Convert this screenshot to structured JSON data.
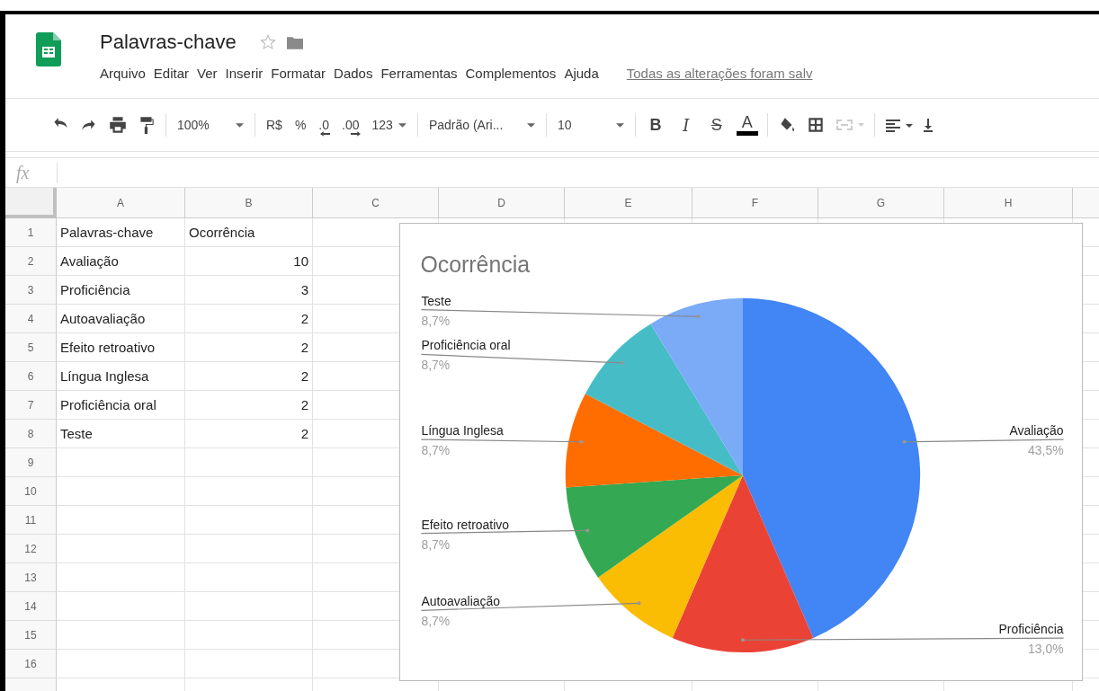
{
  "document": {
    "title": "Palavras-chave",
    "starred": false
  },
  "menu": [
    "Arquivo",
    "Editar",
    "Ver",
    "Inserir",
    "Formatar",
    "Dados",
    "Ferramentas",
    "Complementos",
    "Ajuda"
  ],
  "save_status": "Todas as alterações foram salv",
  "toolbar": {
    "zoom": "100%",
    "currency": "R$",
    "percent": "%",
    "decrease_decimals": ".0",
    "increase_decimals": ".00",
    "number_format": "123",
    "font": "Padrão (Ari...",
    "font_size": "10",
    "format_buttons": [
      {
        "label": "B",
        "kind": "bold"
      },
      {
        "label": "I",
        "kind": "italic"
      },
      {
        "label": "S",
        "kind": "strike"
      },
      {
        "label": "A",
        "kind": "color"
      }
    ],
    "merge_disabled": true
  },
  "formula_bar": {
    "label": "fx"
  },
  "columns": [
    "A",
    "B",
    "C",
    "D",
    "E",
    "F",
    "G",
    "H"
  ],
  "rows": [
    {
      "number": "1",
      "cells": [
        {
          "text": "Palavras-chave",
          "numeric": false
        },
        {
          "text": "Ocorrência",
          "numeric": false
        }
      ]
    },
    {
      "number": "2",
      "cells": [
        {
          "text": "Avaliação",
          "numeric": false
        },
        {
          "text": "10",
          "numeric": true
        }
      ]
    },
    {
      "number": "3",
      "cells": [
        {
          "text": "Proficiência",
          "numeric": false
        },
        {
          "text": "3",
          "numeric": true
        }
      ]
    },
    {
      "number": "4",
      "cells": [
        {
          "text": "Autoavaliação",
          "numeric": false
        },
        {
          "text": "2",
          "numeric": true
        }
      ]
    },
    {
      "number": "5",
      "cells": [
        {
          "text": "Efeito retroativo",
          "numeric": false
        },
        {
          "text": "2",
          "numeric": true
        }
      ]
    },
    {
      "number": "6",
      "cells": [
        {
          "text": "Língua Inglesa",
          "numeric": false
        },
        {
          "text": "2",
          "numeric": true
        }
      ]
    },
    {
      "number": "7",
      "cells": [
        {
          "text": "Proficiência oral",
          "numeric": false
        },
        {
          "text": "2",
          "numeric": true
        }
      ]
    },
    {
      "number": "8",
      "cells": [
        {
          "text": "Teste",
          "numeric": false
        },
        {
          "text": "2",
          "numeric": true
        }
      ]
    },
    {
      "number": "9",
      "cells": []
    },
    {
      "number": "10",
      "cells": []
    },
    {
      "number": "11",
      "cells": []
    },
    {
      "number": "12",
      "cells": []
    },
    {
      "number": "13",
      "cells": []
    },
    {
      "number": "14",
      "cells": []
    },
    {
      "number": "15",
      "cells": []
    },
    {
      "number": "16",
      "cells": []
    }
  ],
  "chart": {
    "chart_data": {
      "type": "pie",
      "title": "Ocorrência",
      "categories": [
        "Avaliação",
        "Proficiência",
        "Autoavaliação",
        "Efeito retroativo",
        "Língua Inglesa",
        "Proficiência oral",
        "Teste"
      ],
      "values": [
        43.5,
        13.0,
        8.7,
        8.7,
        8.7,
        8.7,
        8.7
      ],
      "colors": [
        "#4285f4",
        "#ea4335",
        "#fbbc04",
        "#34a853",
        "#ff6d01",
        "#46bdc6",
        "#7baaf7"
      ],
      "value_labels": [
        "43,5%",
        "13,0%",
        "8,7%",
        "8,7%",
        "8,7%",
        "8,7%",
        "8,7%"
      ]
    }
  }
}
